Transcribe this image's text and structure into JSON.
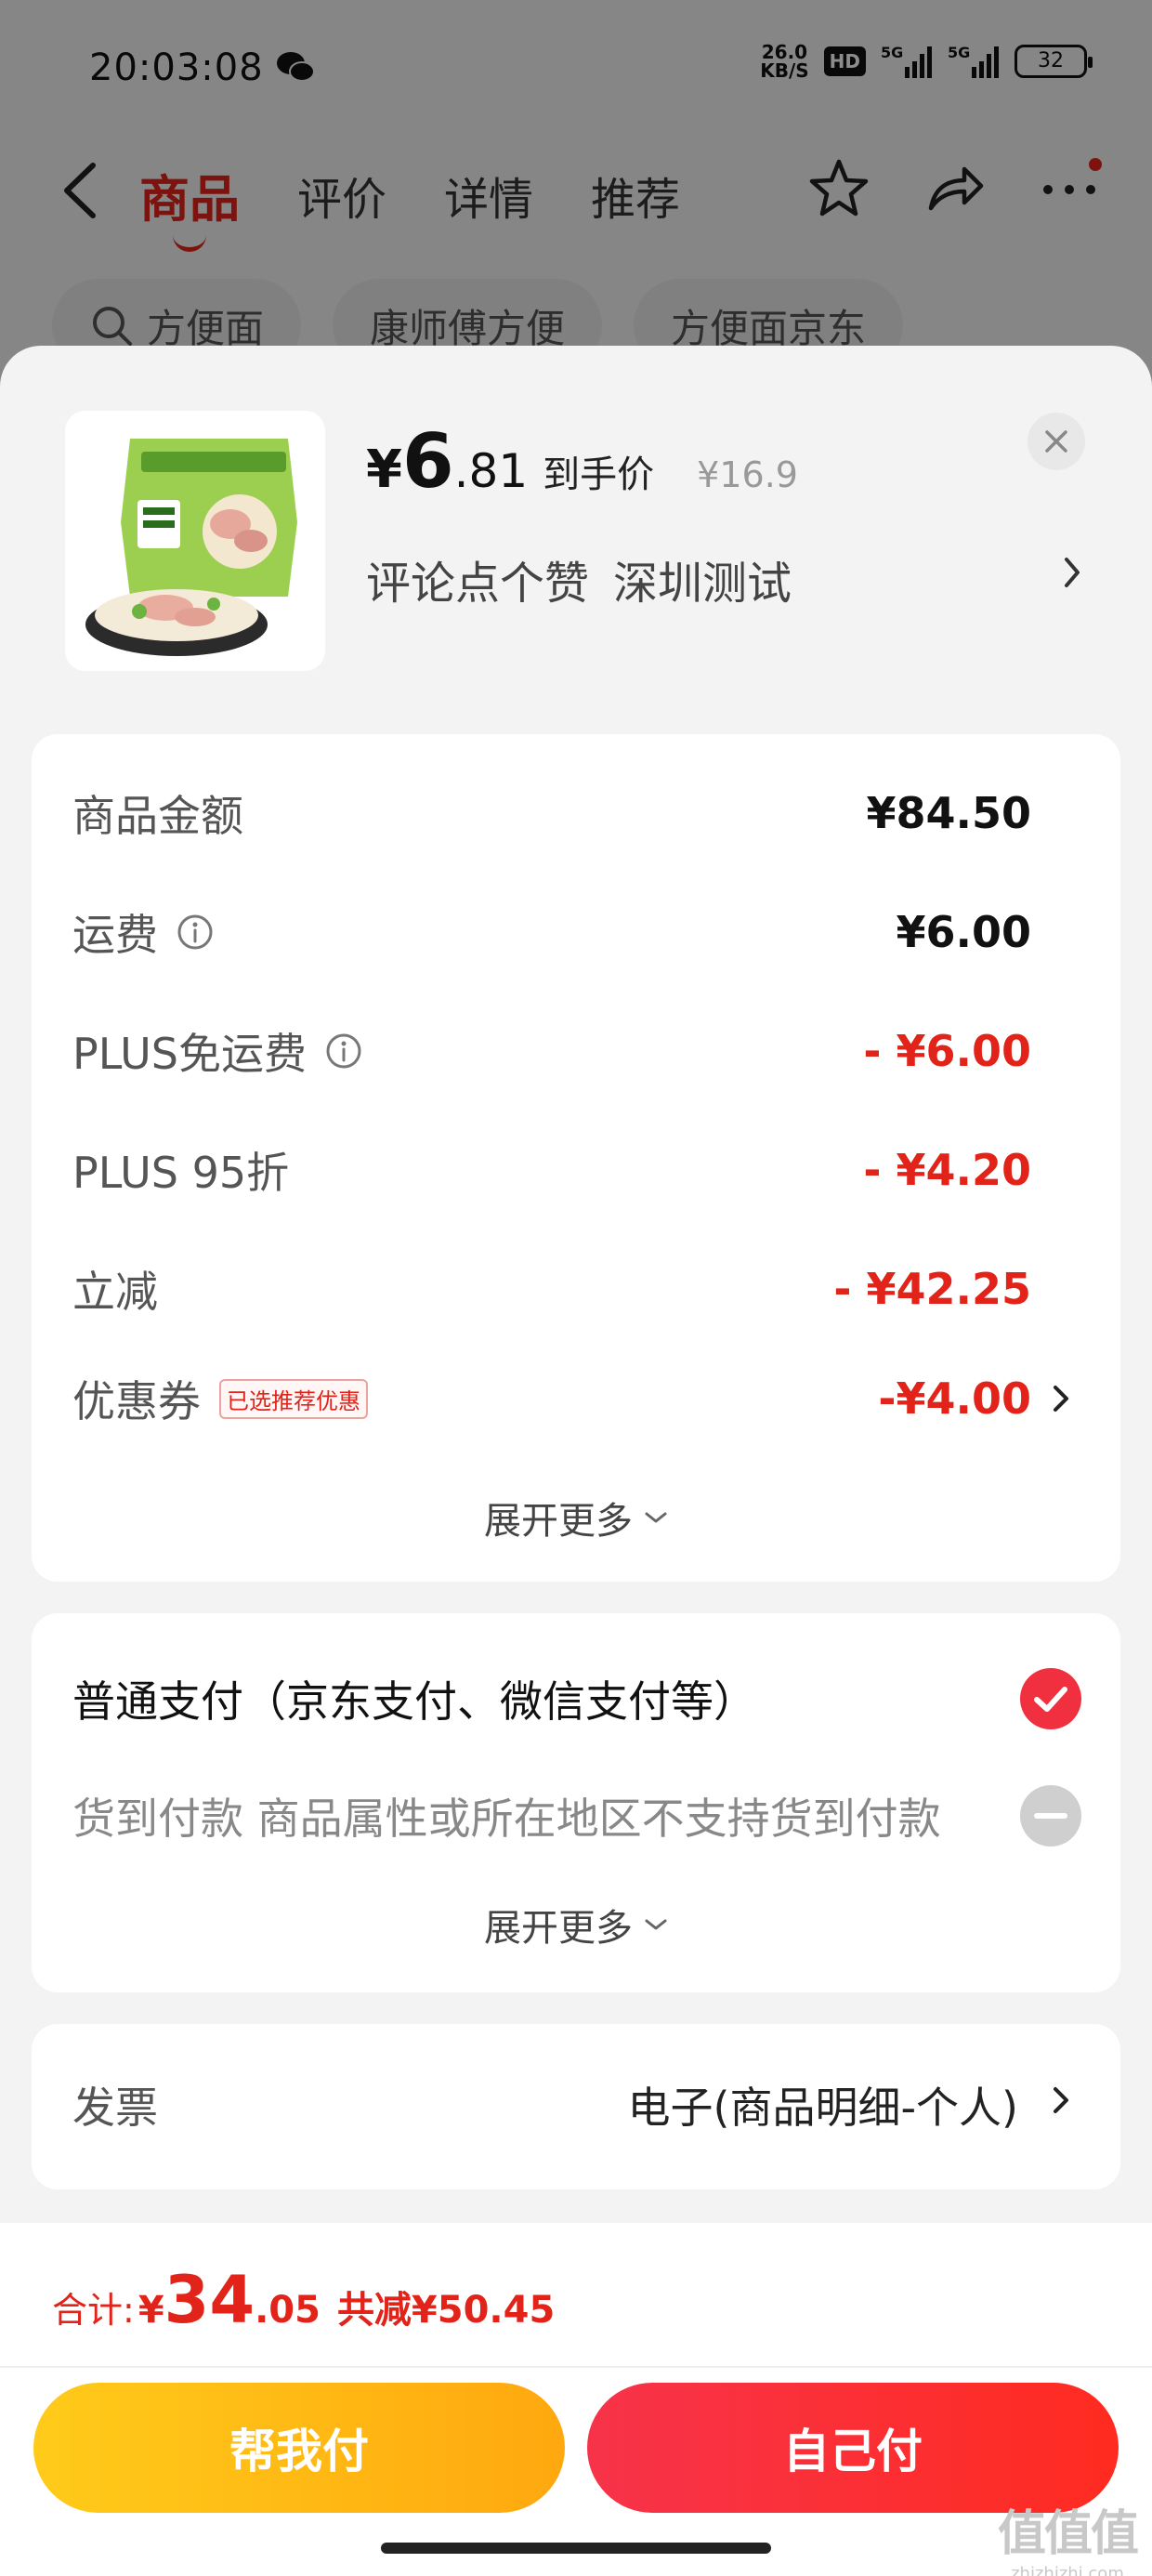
{
  "status_bar": {
    "time": "20:03:08",
    "net_speed_value": "26.0",
    "net_speed_unit": "KB/S",
    "hd_label": "HD",
    "signal_1": "5G",
    "signal_2": "5G",
    "battery": "32"
  },
  "nav": {
    "tabs": [
      {
        "label": "商品",
        "active": true
      },
      {
        "label": "评价",
        "active": false
      },
      {
        "label": "详情",
        "active": false
      },
      {
        "label": "推荐",
        "active": false
      }
    ]
  },
  "background": {
    "chips": [
      "方便面",
      "康师傅方便",
      "方便面京东"
    ]
  },
  "product": {
    "price_yen": "¥",
    "price_int": "6",
    "price_dec": ".81",
    "price_tag": "到手价",
    "price_original": "¥16.9",
    "spec_1": "评论点个赞",
    "spec_2": "深圳测试"
  },
  "fees": {
    "rows": [
      {
        "label": "商品金额",
        "value": "¥84.50",
        "red": false,
        "info": false
      },
      {
        "label": "运费",
        "value": "¥6.00",
        "red": false,
        "info": true
      },
      {
        "label": "PLUS免运费",
        "value": "- ¥6.00",
        "red": true,
        "info": true
      },
      {
        "label": "PLUS 95折",
        "value": "- ¥4.20",
        "red": true,
        "info": false
      },
      {
        "label": "立减",
        "value": "- ¥42.25",
        "red": true,
        "info": false
      },
      {
        "label": "优惠券",
        "value": "-¥4.00",
        "red": true,
        "info": false
      }
    ],
    "coupon_badge": "已选推荐优惠",
    "expand_label": "展开更多"
  },
  "payment": {
    "option_1": "普通支付（京东支付、微信支付等）",
    "option_2": "货到付款 商品属性或所在地区不支持货到付款",
    "expand_label": "展开更多",
    "check_color": "#f0303f"
  },
  "invoice": {
    "label": "发票",
    "value": "电子(商品明细-个人)"
  },
  "footer": {
    "total_label": "合计:",
    "total_yen": "¥",
    "total_int": "34",
    "total_dec": ".05",
    "total_save": "共减¥50.45",
    "btn_help": "帮我付",
    "btn_self": "自己付"
  },
  "watermark": {
    "logo": "值值值",
    "url": "zhizhizhi.com"
  },
  "colors": {
    "accent_red": "#e2231a",
    "help_button": "#ffb812",
    "self_button": "#f7334a"
  }
}
